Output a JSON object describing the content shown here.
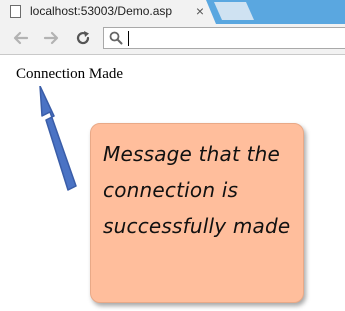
{
  "tab": {
    "title": "localhost:53003/Demo.asp",
    "close": "×",
    "favicon": "page-icon"
  },
  "toolbar": {
    "back_icon": "back-arrow-icon",
    "forward_icon": "forward-arrow-icon",
    "reload_icon": "reload-icon",
    "search_icon": "search-icon",
    "address_value": ""
  },
  "page": {
    "message": "Connection Made"
  },
  "annotation": {
    "text": "Message that the connection is successfully made",
    "callout_color": "#ffbe9c",
    "arrow_color": "#4b73c4"
  }
}
